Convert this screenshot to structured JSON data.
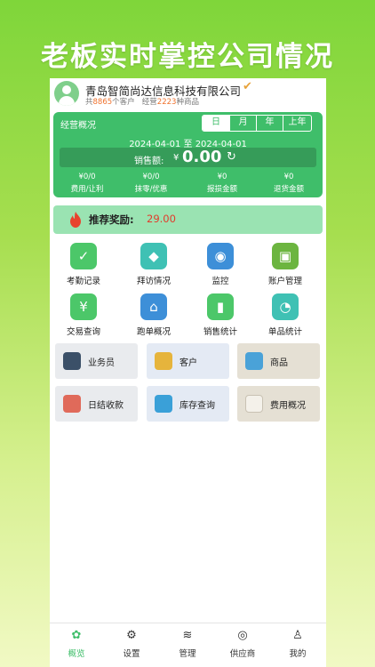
{
  "hero": {
    "title": "老板实时掌控公司情况"
  },
  "company": {
    "name": "青岛智简尚达信息科技有限公司",
    "stats_prefix": "共",
    "customer_count": "8865",
    "customer_suffix": "个客户",
    "product_prefix": "经营",
    "product_count": "2223",
    "product_suffix": "种商品"
  },
  "summary": {
    "title": "经营概况",
    "tabs": [
      "日",
      "月",
      "年",
      "上年"
    ],
    "date_start": "2024-04-01",
    "date_sep": "至",
    "date_end": "2024-04-01",
    "sales_label": "销售额:",
    "currency": "¥",
    "sales_value": "0.00",
    "metrics": [
      {
        "value": "¥0/0",
        "label": "费用/让利"
      },
      {
        "value": "¥0/0",
        "label": "抹零/优惠"
      },
      {
        "value": "¥0",
        "label": "报损金额"
      },
      {
        "value": "¥0",
        "label": "退货金额"
      }
    ]
  },
  "reward": {
    "label": "推荐奖励:",
    "value": "29.00"
  },
  "grid": [
    {
      "label": "考勤记录",
      "icon": "calendar-check-icon",
      "color": "#4cc769"
    },
    {
      "label": "拜访情况",
      "icon": "tag-icon",
      "color": "#3fc1b4"
    },
    {
      "label": "监控",
      "icon": "camera-icon",
      "color": "#3d8fd8"
    },
    {
      "label": "账户管理",
      "icon": "wallet-icon",
      "color": "#6cb540"
    },
    {
      "label": "交易查询",
      "icon": "coin-icon",
      "color": "#4cc769"
    },
    {
      "label": "跑单概况",
      "icon": "location-icon",
      "color": "#3d8fd8"
    },
    {
      "label": "销售统计",
      "icon": "bar-chart-icon",
      "color": "#4cc769"
    },
    {
      "label": "单品统计",
      "icon": "pie-chart-icon",
      "color": "#3fc1b4"
    }
  ],
  "tiles": [
    {
      "label": "业务员",
      "icon": "person-icon"
    },
    {
      "label": "客户",
      "icon": "customers-icon"
    },
    {
      "label": "商品",
      "icon": "box-icon"
    },
    {
      "label": "日结收款",
      "icon": "payment-icon"
    },
    {
      "label": "库存查询",
      "icon": "inventory-icon"
    },
    {
      "label": "费用概况",
      "icon": "expense-icon"
    }
  ],
  "nav": [
    {
      "label": "概览",
      "icon": "overview-icon",
      "active": true
    },
    {
      "label": "设置",
      "icon": "settings-icon",
      "active": false
    },
    {
      "label": "管理",
      "icon": "layers-icon",
      "active": false
    },
    {
      "label": "供应商",
      "icon": "supplier-icon",
      "active": false
    },
    {
      "label": "我的",
      "icon": "profile-icon",
      "active": false
    }
  ],
  "colors": {
    "accent": "#3fbe6a",
    "reward_value": "#e23b2c",
    "count_highlight": "#f0732f"
  }
}
